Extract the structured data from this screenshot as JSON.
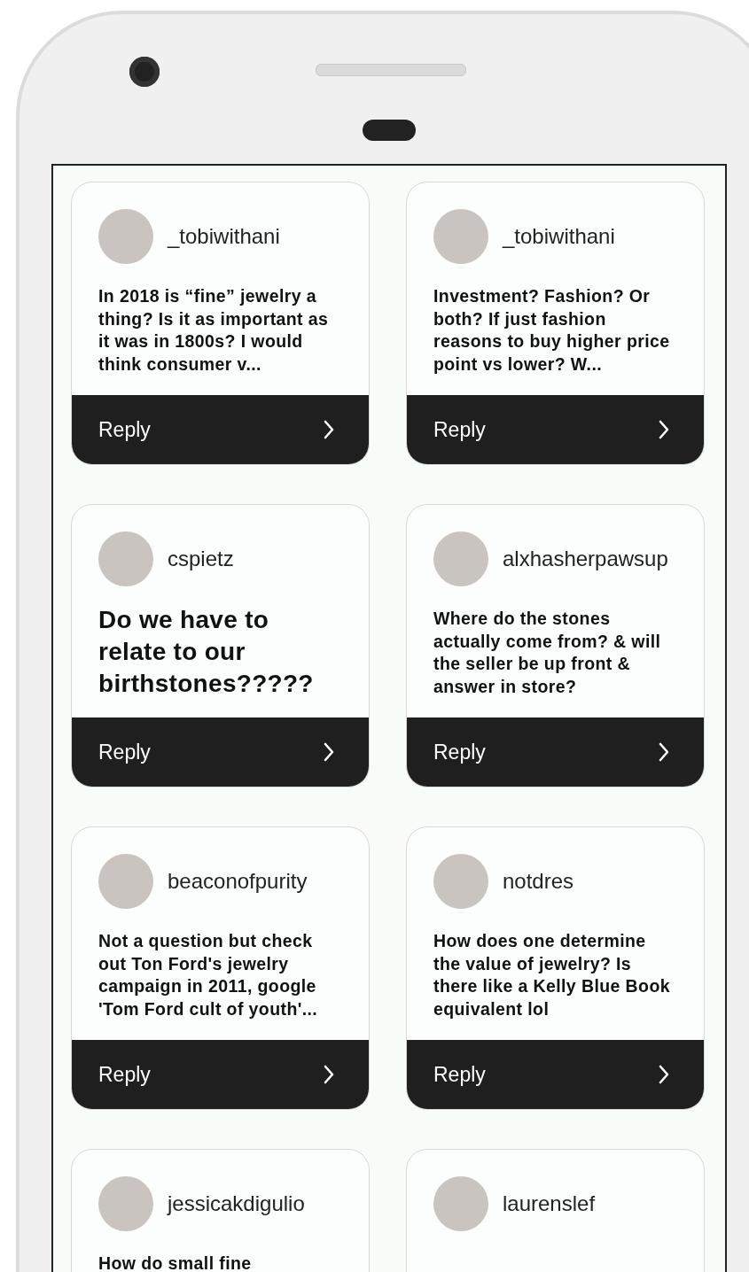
{
  "cards": [
    {
      "username": "_tobiwithani",
      "question": "In 2018 is “fine” jewelry a thing? Is it as important as it was in 1800s? I would think consumer v...",
      "kind": "normal",
      "reply": "Reply"
    },
    {
      "username": "_tobiwithani",
      "question": "Investment? Fashion? Or both? If just fashion reasons to buy higher price point vs lower? W...",
      "kind": "normal",
      "reply": "Reply"
    },
    {
      "username": "cspietz",
      "question": "Do we have to relate to our birthstones?????",
      "kind": "large",
      "reply": "Reply"
    },
    {
      "username": "alxhasherpawsup",
      "question": "Where do the stones actually come from? & will the seller be up front & answer in store?",
      "kind": "normal",
      "reply": "Reply"
    },
    {
      "username": "beaconofpurity",
      "question": "Not a question but check out Ton Ford's jewelry campaign in 2011, google 'Tom Ford cult of youth'...",
      "kind": "normal",
      "reply": "Reply"
    },
    {
      "username": "notdres",
      "question": "How does one determine the value of jewelry? Is there like a Kelly Blue Book equivalent lol",
      "kind": "normal",
      "reply": "Reply"
    },
    {
      "username": "jessicakdigulio",
      "question": "How do small fine",
      "kind": "normal"
    },
    {
      "username": "laurenslef"
    }
  ]
}
